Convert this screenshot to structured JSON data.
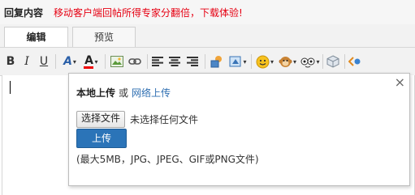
{
  "header": {
    "title": "回复内容",
    "promo": "移动客户端回帖所得专家分翻倍，下载体验!",
    "promo_color": "#e60012"
  },
  "tabs": [
    {
      "label": "编辑",
      "active": true
    },
    {
      "label": "预览",
      "active": false
    }
  ],
  "toolbar": {
    "bold": "B",
    "italic": "I",
    "underline": "U",
    "font": "A",
    "color": "A",
    "icons": [
      "bold-icon",
      "italic-icon",
      "underline-icon",
      "font-icon",
      "font-color-icon",
      "image-icon",
      "link-icon",
      "align-left-icon",
      "align-center-icon",
      "align-right-icon",
      "upload-image-icon",
      "insert-icon",
      "smiley-icon",
      "monkey-emoticon-icon",
      "emoticon-icon",
      "box-icon",
      "share-icon"
    ]
  },
  "upload": {
    "local_label": "本地上传",
    "or": "或",
    "network_label": "网络上传",
    "choose_file": "选择文件",
    "file_status": "未选择任何文件",
    "upload_button": "上传",
    "hint": "(最大5MB，JPG、JPEG、GIF或PNG文件)",
    "close": "×",
    "button_color": "#2b74b8",
    "link_color": "#2f6fb2"
  }
}
